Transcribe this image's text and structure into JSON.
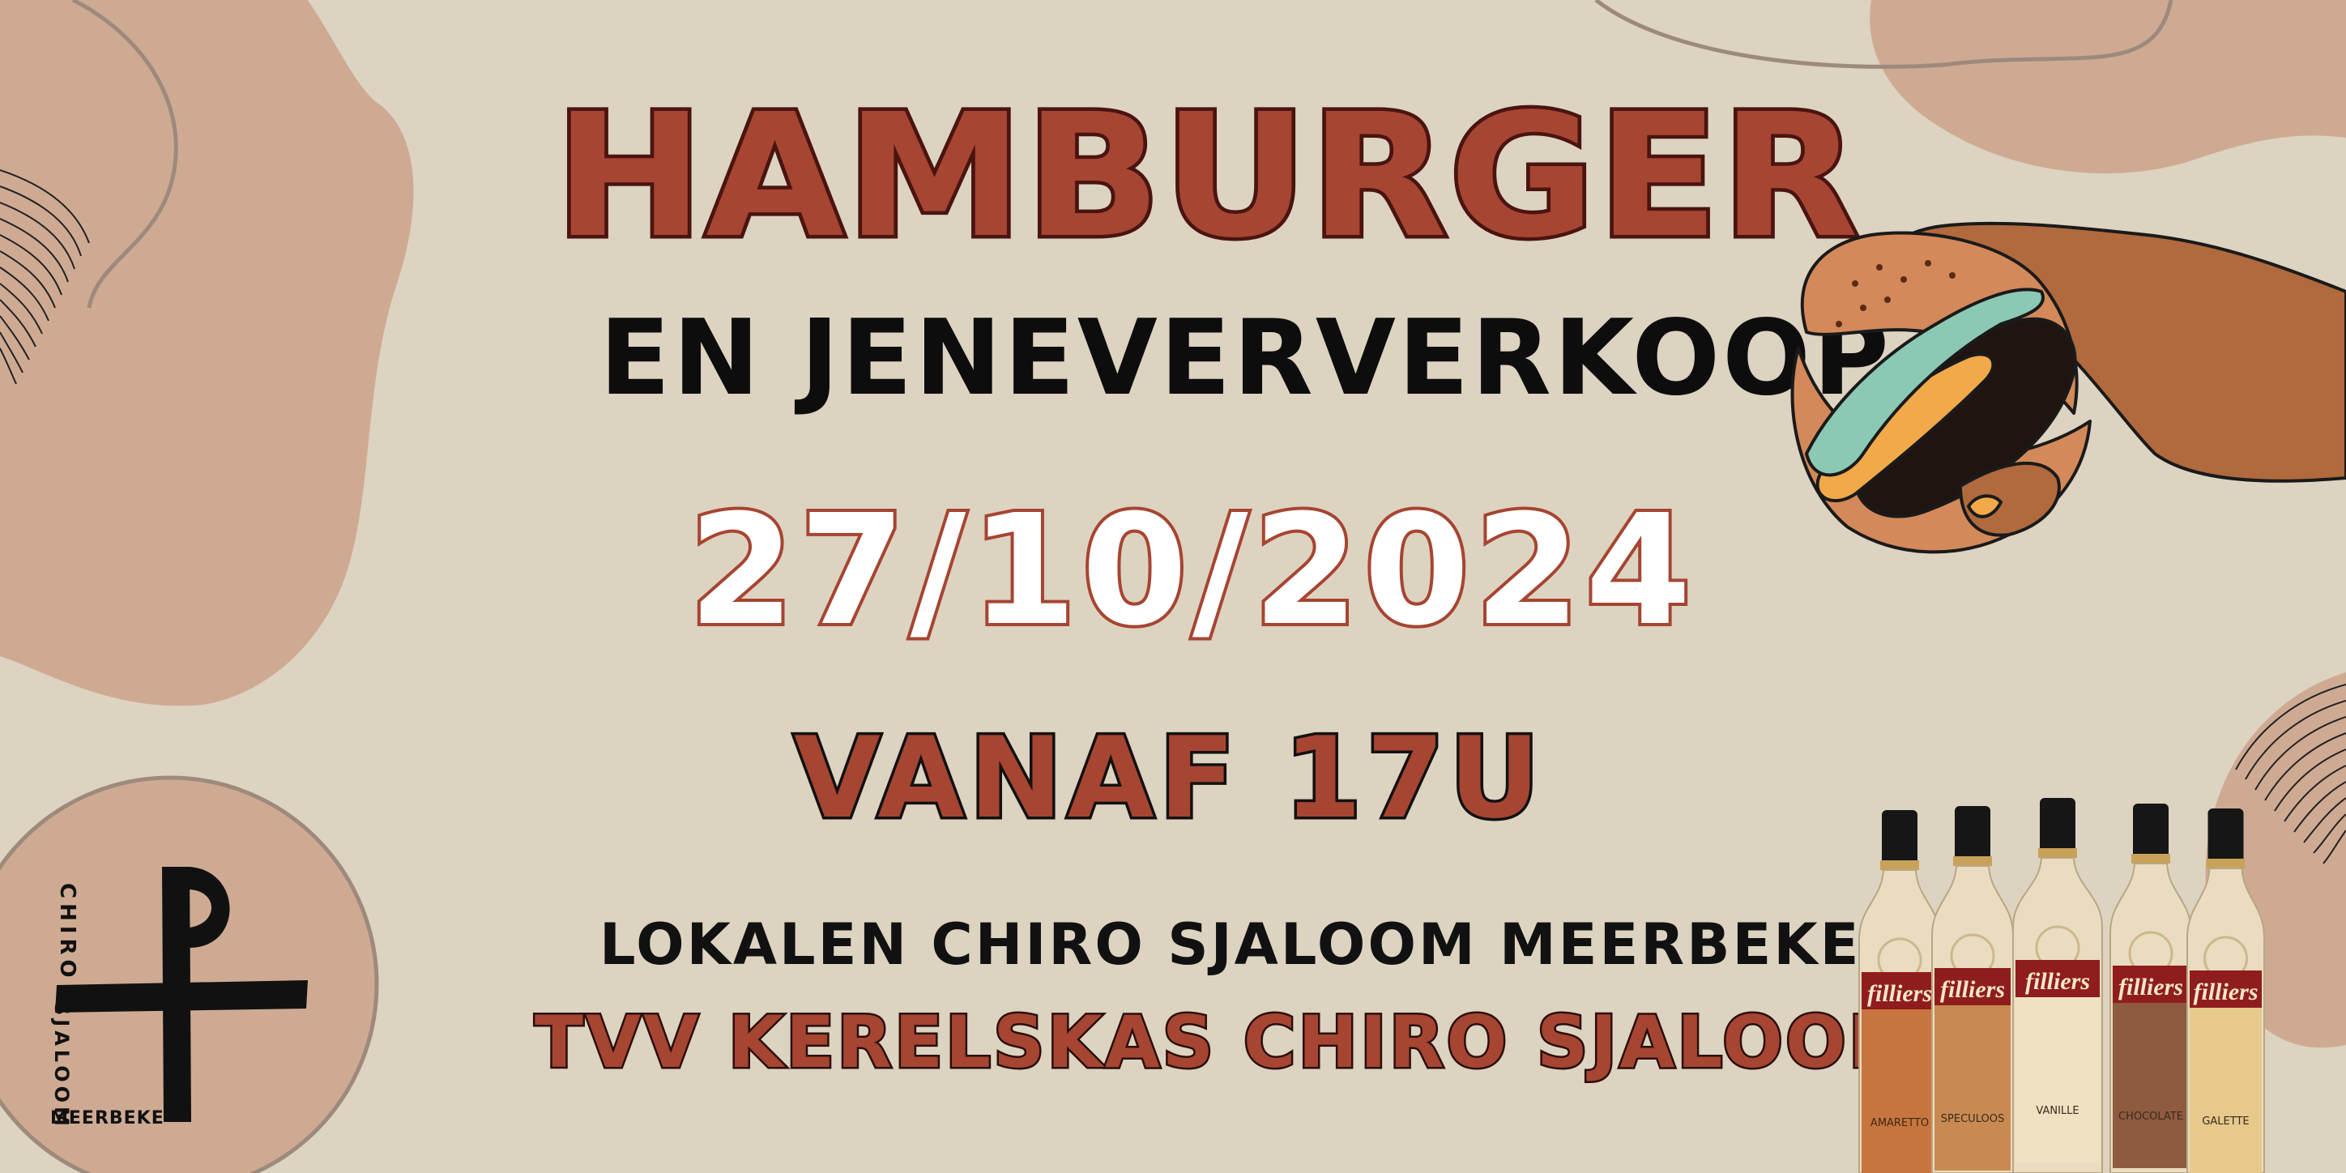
{
  "poster": {
    "title": "HAMBURGER",
    "subtitle": "EN JENEVERVERKOOP",
    "date": "27/10/2024",
    "time": "VANAF 17U",
    "location": "LOKALEN CHIRO SJALOOM MEERBEKE",
    "organizer": "TVV KERELSKAS CHIRO SJALOOM"
  },
  "logo": {
    "line1": "CHIRO",
    "line2": "SJALOOM",
    "line3": "MEERBEKE"
  },
  "bottles": [
    {
      "brand": "filliers",
      "flavor": "AMARETTO",
      "color": "#c8743e"
    },
    {
      "brand": "filliers",
      "flavor": "SPECULOOS",
      "color": "#c98a52"
    },
    {
      "brand": "filliers",
      "flavor": "VANILLE",
      "color": "#efe2c2"
    },
    {
      "brand": "filliers",
      "flavor": "CHOCOLATE",
      "color": "#8e5b40"
    },
    {
      "brand": "filliers",
      "flavor": "GALETTE",
      "color": "#e6c98b"
    }
  ],
  "colors": {
    "background": "#ddd3c1",
    "blob": "#cfaa93",
    "accent": "#a64532",
    "dark": "#111111"
  },
  "icons": [
    "hand-holding-burger-illustration",
    "chiro-cross-logo",
    "jenever-bottles"
  ]
}
